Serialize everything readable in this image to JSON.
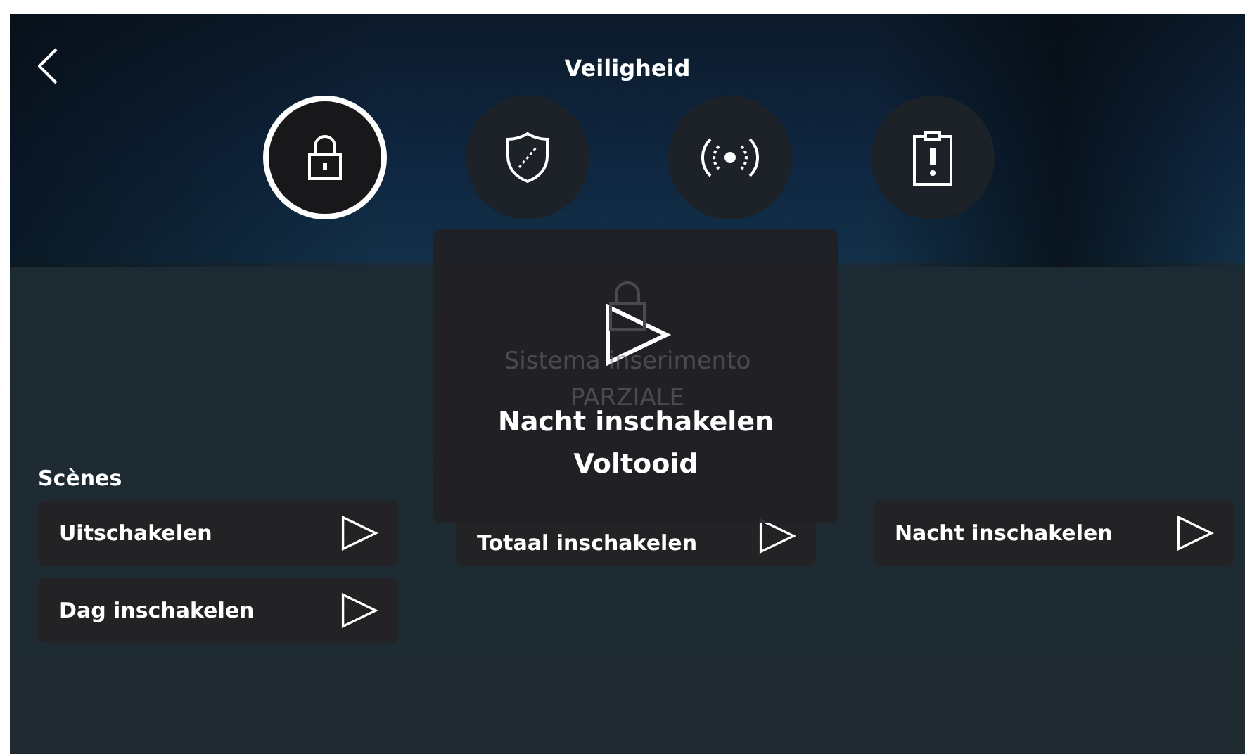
{
  "header": {
    "title": "Veiligheid"
  },
  "modes": [
    {
      "kind": "lock",
      "selected": true
    },
    {
      "kind": "shield",
      "selected": false
    },
    {
      "kind": "signal",
      "selected": false
    },
    {
      "kind": "clipboard",
      "selected": false
    }
  ],
  "status": {
    "lines": [
      "Sistema inserimento",
      "PARZIALE"
    ]
  },
  "scenes": {
    "label": "Scènes",
    "items": [
      {
        "label": "Uitschakelen"
      },
      {
        "label": "Totaal inschakelen"
      },
      {
        "label": "Nacht inschakelen"
      },
      {
        "label": "Dag inschakelen"
      }
    ]
  },
  "popup": {
    "title": "Nacht inschakelen",
    "status": "Voltooid"
  }
}
